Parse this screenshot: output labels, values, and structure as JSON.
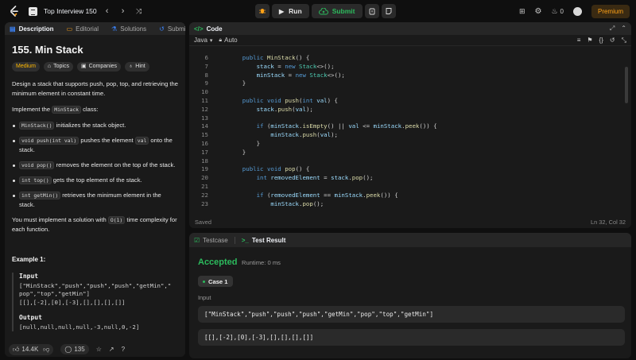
{
  "nav": {
    "title": "Top Interview 150",
    "run_label": "Run",
    "submit_label": "Submit",
    "streak_count": "0",
    "premium_label": "Premium"
  },
  "left_tabs": [
    "Description",
    "Editorial",
    "Solutions",
    "Submission"
  ],
  "problem": {
    "title": "155. Min Stack",
    "chips": [
      "Medium",
      "Topics",
      "Companies",
      "Hint"
    ],
    "intro": "Design a stack that supports push, pop, top, and retrieving the minimum element in constant time.",
    "implement_pre": "Implement the ",
    "implement_code": "MinStack",
    "implement_post": " class:",
    "methods": [
      {
        "code": "MinStack()",
        "text": " initializes the stack object."
      },
      {
        "code": "void push(int val)",
        "text": " pushes the element ",
        "code2": "val",
        "text2": " onto the stack."
      },
      {
        "code": "void pop()",
        "text": " removes the element on the top of the stack."
      },
      {
        "code": "int top()",
        "text": " gets the top element of the stack."
      },
      {
        "code": "int getMin()",
        "text": " retrieves the minimum element in the stack."
      }
    ],
    "complexity_pre": "You must implement a solution with ",
    "complexity_code": "O(1)",
    "complexity_post": " time complexity for each function.",
    "example_title": "Example 1:",
    "input_label": "Input",
    "input_line1": "[\"MinStack\",\"push\",\"push\",\"push\",\"getMin\",\"",
    "input_line2": "pop\",\"top\",\"getMin\"]",
    "input_line3": "[[],[-2],[0],[-3],[],[],[],[]]",
    "output_label": "Output",
    "output_line1": "[null,null,null,null,-3,null,0,-2]"
  },
  "bottom_bar": {
    "likes": "14.4K",
    "comments": "135"
  },
  "code_panel": {
    "title": "Code",
    "language": "Java",
    "mode": "Auto",
    "status": "Saved",
    "cursor": "Ln 32, Col 32",
    "lines": [
      {
        "n": "6",
        "code": "    public MinStack() {"
      },
      {
        "n": "7",
        "code": "        stack = new Stack<>();"
      },
      {
        "n": "8",
        "code": "        minStack = new Stack<>();"
      },
      {
        "n": "9",
        "code": "    }"
      },
      {
        "n": "10",
        "code": ""
      },
      {
        "n": "11",
        "code": "    public void push(int val) {"
      },
      {
        "n": "12",
        "code": "        stack.push(val);"
      },
      {
        "n": "13",
        "code": ""
      },
      {
        "n": "14",
        "code": "        if (minStack.isEmpty() || val <= minStack.peek()) {"
      },
      {
        "n": "15",
        "code": "            minStack.push(val);"
      },
      {
        "n": "16",
        "code": "        }"
      },
      {
        "n": "17",
        "code": "    }"
      },
      {
        "n": "18",
        "code": ""
      },
      {
        "n": "19",
        "code": "    public void pop() {"
      },
      {
        "n": "20",
        "code": "        int removedElement = stack.pop();"
      },
      {
        "n": "21",
        "code": ""
      },
      {
        "n": "22",
        "code": "        if (removedElement == minStack.peek()) {"
      },
      {
        "n": "23",
        "code": "            minStack.pop();"
      }
    ]
  },
  "result_panel": {
    "tab_testcase": "Testcase",
    "tab_result": "Test Result",
    "verdict": "Accepted",
    "runtime": "Runtime: 0 ms",
    "case_label": "Case 1",
    "input_label": "Input",
    "input_value1": "[\"MinStack\",\"push\",\"push\",\"push\",\"getMin\",\"pop\",\"top\",\"getMin\"]",
    "input_value2": "[[],[-2],[0],[-3],[],[],[],[]]"
  },
  "colors": {
    "accent": "#ffa116",
    "accepted": "#2cbb5d",
    "medium": "#ffb800"
  }
}
